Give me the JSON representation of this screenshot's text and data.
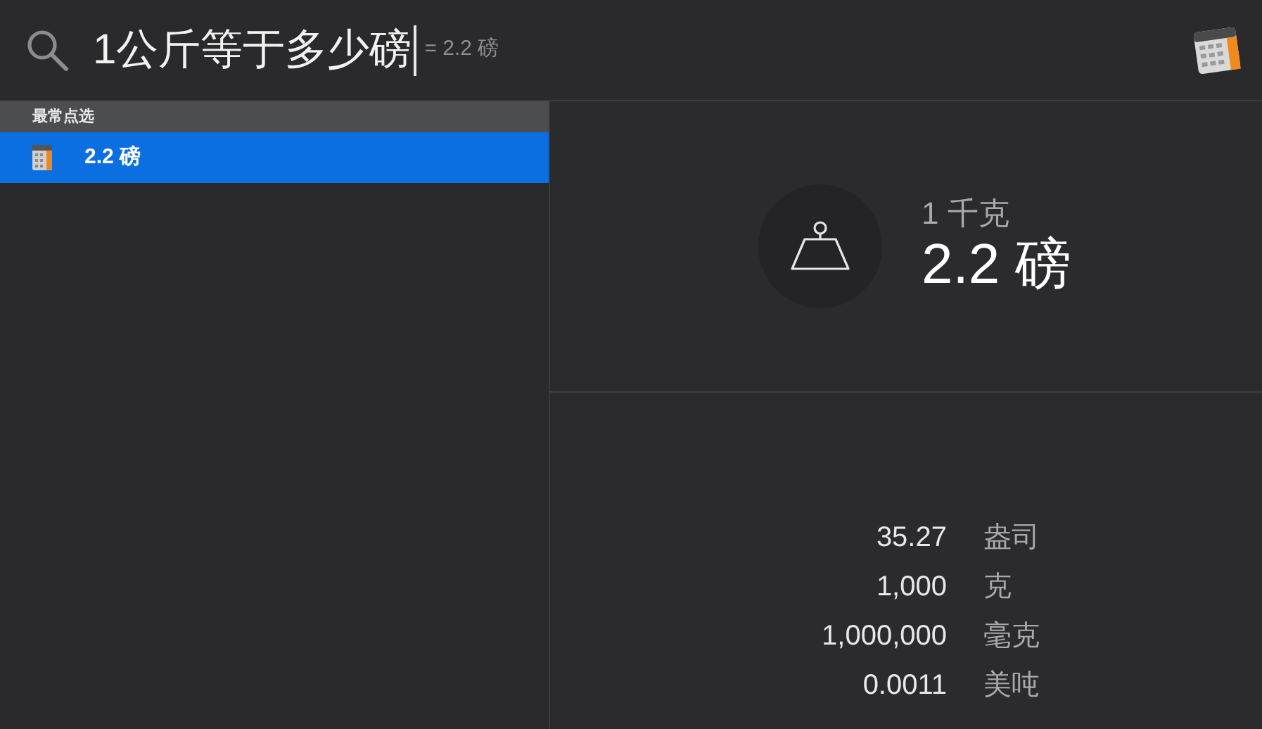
{
  "search": {
    "query": "1公斤等于多少磅",
    "completion": "= 2.2 磅"
  },
  "sidebar": {
    "section": "最常点选",
    "items": [
      {
        "label": "2.2 磅",
        "selected": true
      }
    ]
  },
  "preview": {
    "source": "1 千克",
    "result": "2.2 磅",
    "conversions": [
      {
        "value": "35.27",
        "unit": "盎司"
      },
      {
        "value": "1,000",
        "unit": "克"
      },
      {
        "value": "1,000,000",
        "unit": "毫克"
      },
      {
        "value": "0.0011",
        "unit": "美吨"
      }
    ]
  }
}
